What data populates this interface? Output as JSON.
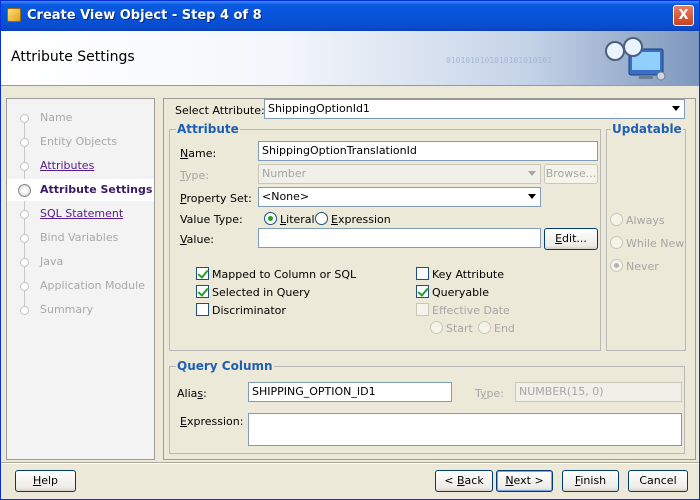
{
  "window": {
    "title": "Create View Object - Step 4 of 8",
    "close_label": "X"
  },
  "header": {
    "page_title": "Attribute Settings",
    "binary_text": "0101010101010101010101"
  },
  "nav": {
    "items": [
      {
        "label": "Name",
        "state": "disabled"
      },
      {
        "label": "Entity Objects",
        "state": "disabled"
      },
      {
        "label": "Attributes",
        "state": "link"
      },
      {
        "label": "Attribute Settings",
        "state": "current"
      },
      {
        "label": "SQL Statement",
        "state": "link"
      },
      {
        "label": "Bind Variables",
        "state": "disabled"
      },
      {
        "label": "Java",
        "state": "disabled"
      },
      {
        "label": "Application Module",
        "state": "disabled"
      },
      {
        "label": "Summary",
        "state": "disabled"
      }
    ]
  },
  "select_attribute": {
    "label": "Select Attribute:",
    "value": "ShippingOptionId1"
  },
  "attribute": {
    "group_title": "Attribute",
    "name_label": "Name:",
    "name_value": "ShippingOptionTranslationId",
    "type_label": "Type:",
    "type_value": "Number",
    "browse_label": "Browse...",
    "property_set_label": "Property Set:",
    "property_set_value": "<None>",
    "value_type_label": "Value Type:",
    "literal_label": "Literal",
    "expression_label": "Expression",
    "value_label": "Value:",
    "value_value": "",
    "edit_label": "Edit...",
    "checks": {
      "mapped": "Mapped to Column or SQL",
      "selected": "Selected in Query",
      "discriminator": "Discriminator",
      "key": "Key Attribute",
      "queryable": "Queryable",
      "effective_date": "Effective Date",
      "start": "Start",
      "end": "End"
    }
  },
  "updatable": {
    "group_title": "Updatable",
    "always": "Always",
    "while_new": "While New",
    "never": "Never"
  },
  "query_column": {
    "group_title": "Query Column",
    "alias_label": "Alias:",
    "alias_value": "SHIPPING_OPTION_ID1",
    "type_label": "Type:",
    "type_value": "NUMBER(15, 0)",
    "expression_label": "Expression:",
    "expression_value": ""
  },
  "footer": {
    "help": "Help",
    "back": "< Back",
    "next": "Next >",
    "finish": "Finish",
    "cancel": "Cancel"
  },
  "colors": {
    "title_bar": "#0653d8",
    "group_title": "#1f5fb3",
    "visited_link": "#551a8b"
  }
}
